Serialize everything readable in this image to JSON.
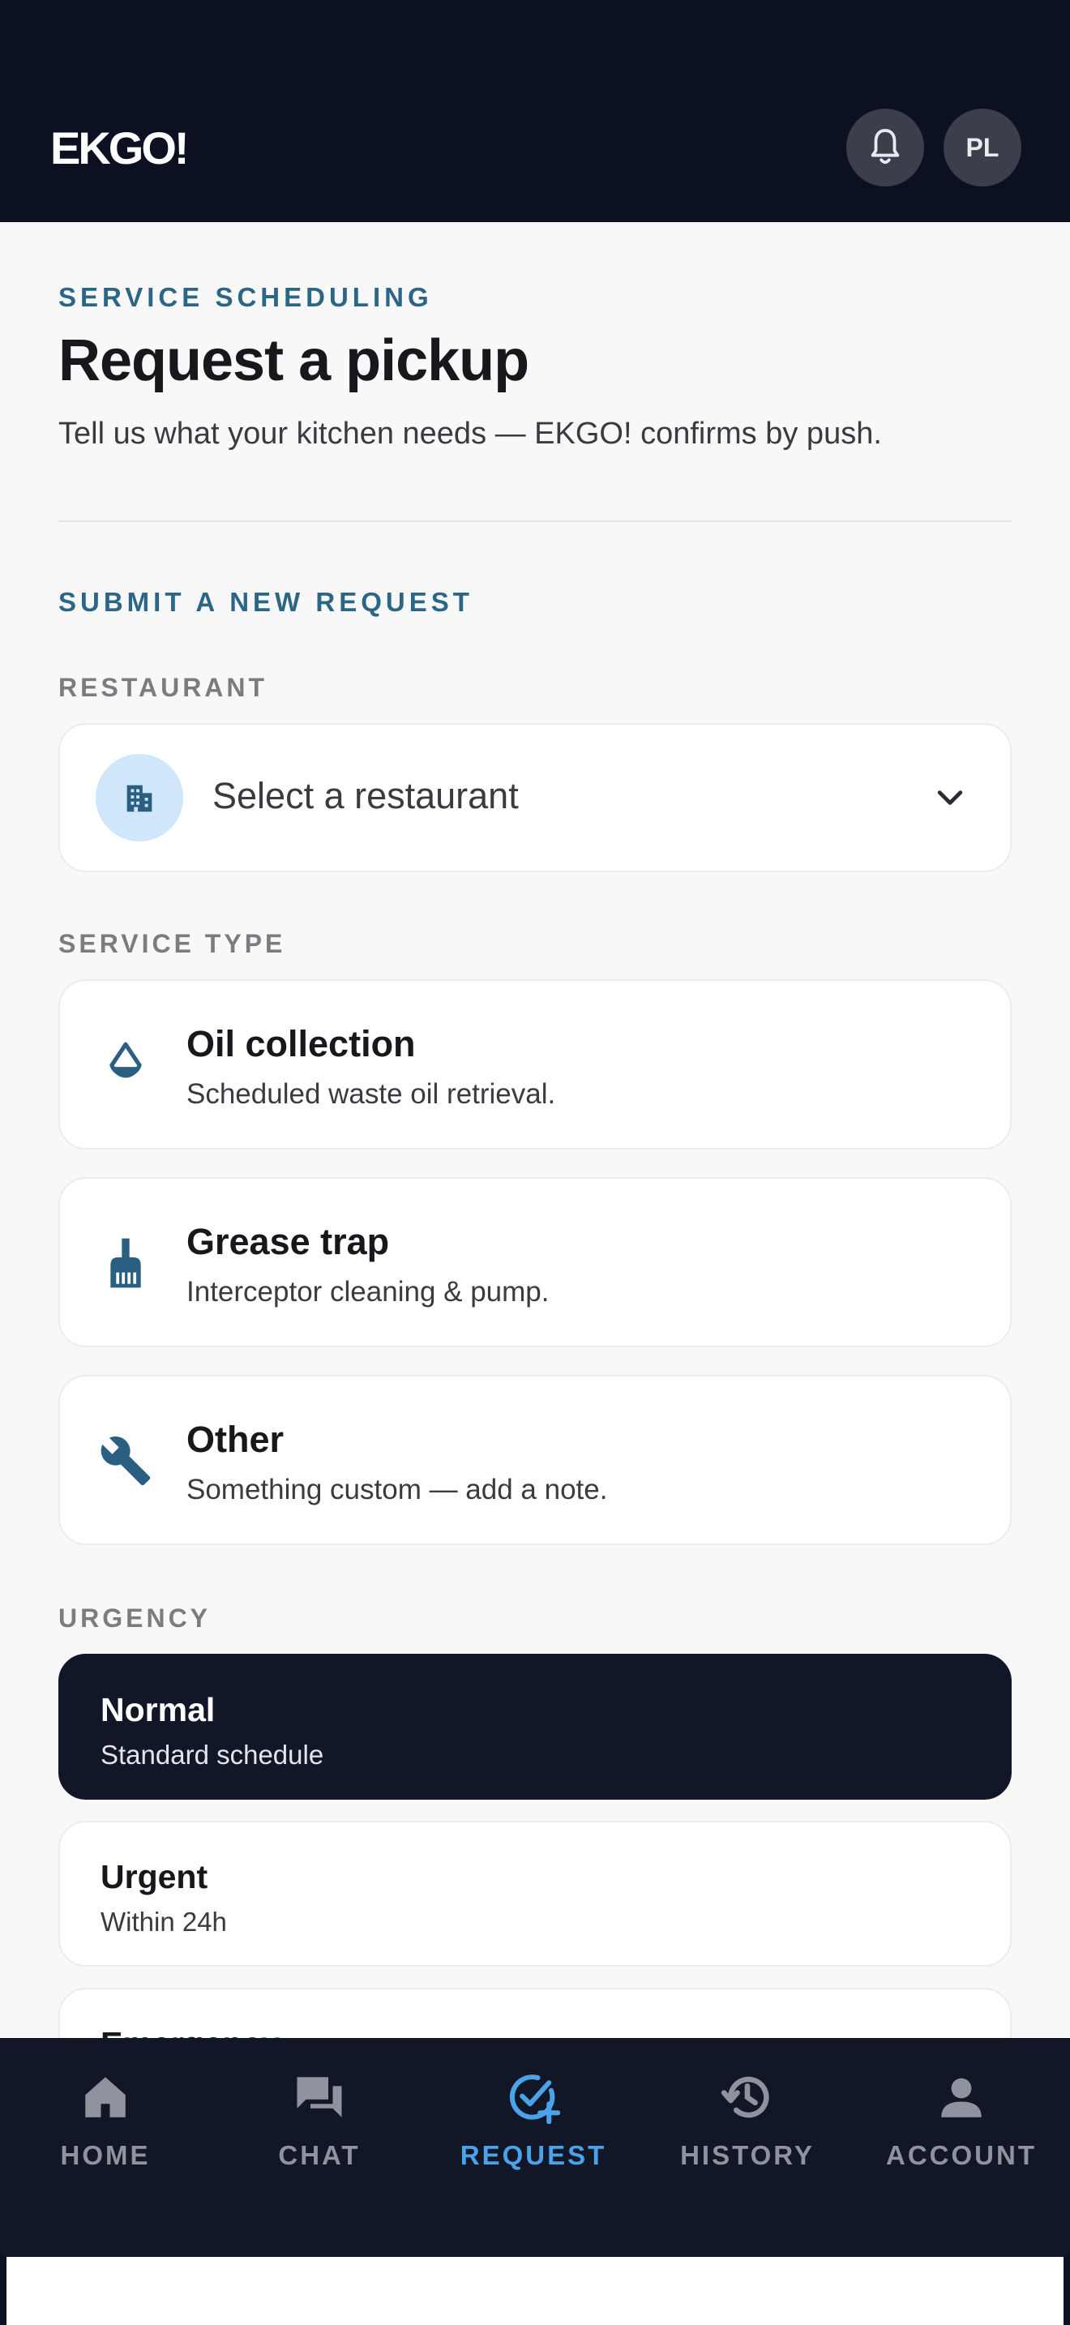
{
  "header": {
    "logo": "EKGO!",
    "avatar_initials": "PL",
    "icons": {
      "notifications": "bell-icon"
    }
  },
  "page": {
    "eyebrow": "SERVICE SCHEDULING",
    "title": "Request a pickup",
    "subtitle": "Tell us what your kitchen needs — EKGO! confirms by push.",
    "section_title": "SUBMIT A NEW REQUEST"
  },
  "restaurant": {
    "label": "RESTAURANT",
    "placeholder": "Select a restaurant",
    "icon": "building-icon"
  },
  "service_type": {
    "label": "SERVICE TYPE",
    "options": [
      {
        "title": "Oil collection",
        "desc": "Scheduled waste oil retrieval.",
        "icon": "oil-drop-icon"
      },
      {
        "title": "Grease trap",
        "desc": "Interceptor cleaning & pump.",
        "icon": "brush-icon"
      },
      {
        "title": "Other",
        "desc": "Something custom — add a note.",
        "icon": "wrench-icon"
      }
    ]
  },
  "urgency": {
    "label": "URGENCY",
    "selected": "Normal",
    "options": [
      {
        "title": "Normal",
        "desc": "Standard schedule"
      },
      {
        "title": "Urgent",
        "desc": "Within 24h"
      },
      {
        "title": "Emergency",
        "desc": ""
      }
    ]
  },
  "tabbar": {
    "active": "REQUEST",
    "tabs": [
      {
        "label": "HOME",
        "icon": "home-icon"
      },
      {
        "label": "CHAT",
        "icon": "chat-icon"
      },
      {
        "label": "REQUEST",
        "icon": "request-check-icon"
      },
      {
        "label": "HISTORY",
        "icon": "history-icon"
      },
      {
        "label": "ACCOUNT",
        "icon": "account-icon"
      }
    ]
  },
  "colors": {
    "header_bg": "#0b1120",
    "accent": "#2c6687",
    "tab_active": "#4aa3e8",
    "selected_card": "#121728"
  }
}
